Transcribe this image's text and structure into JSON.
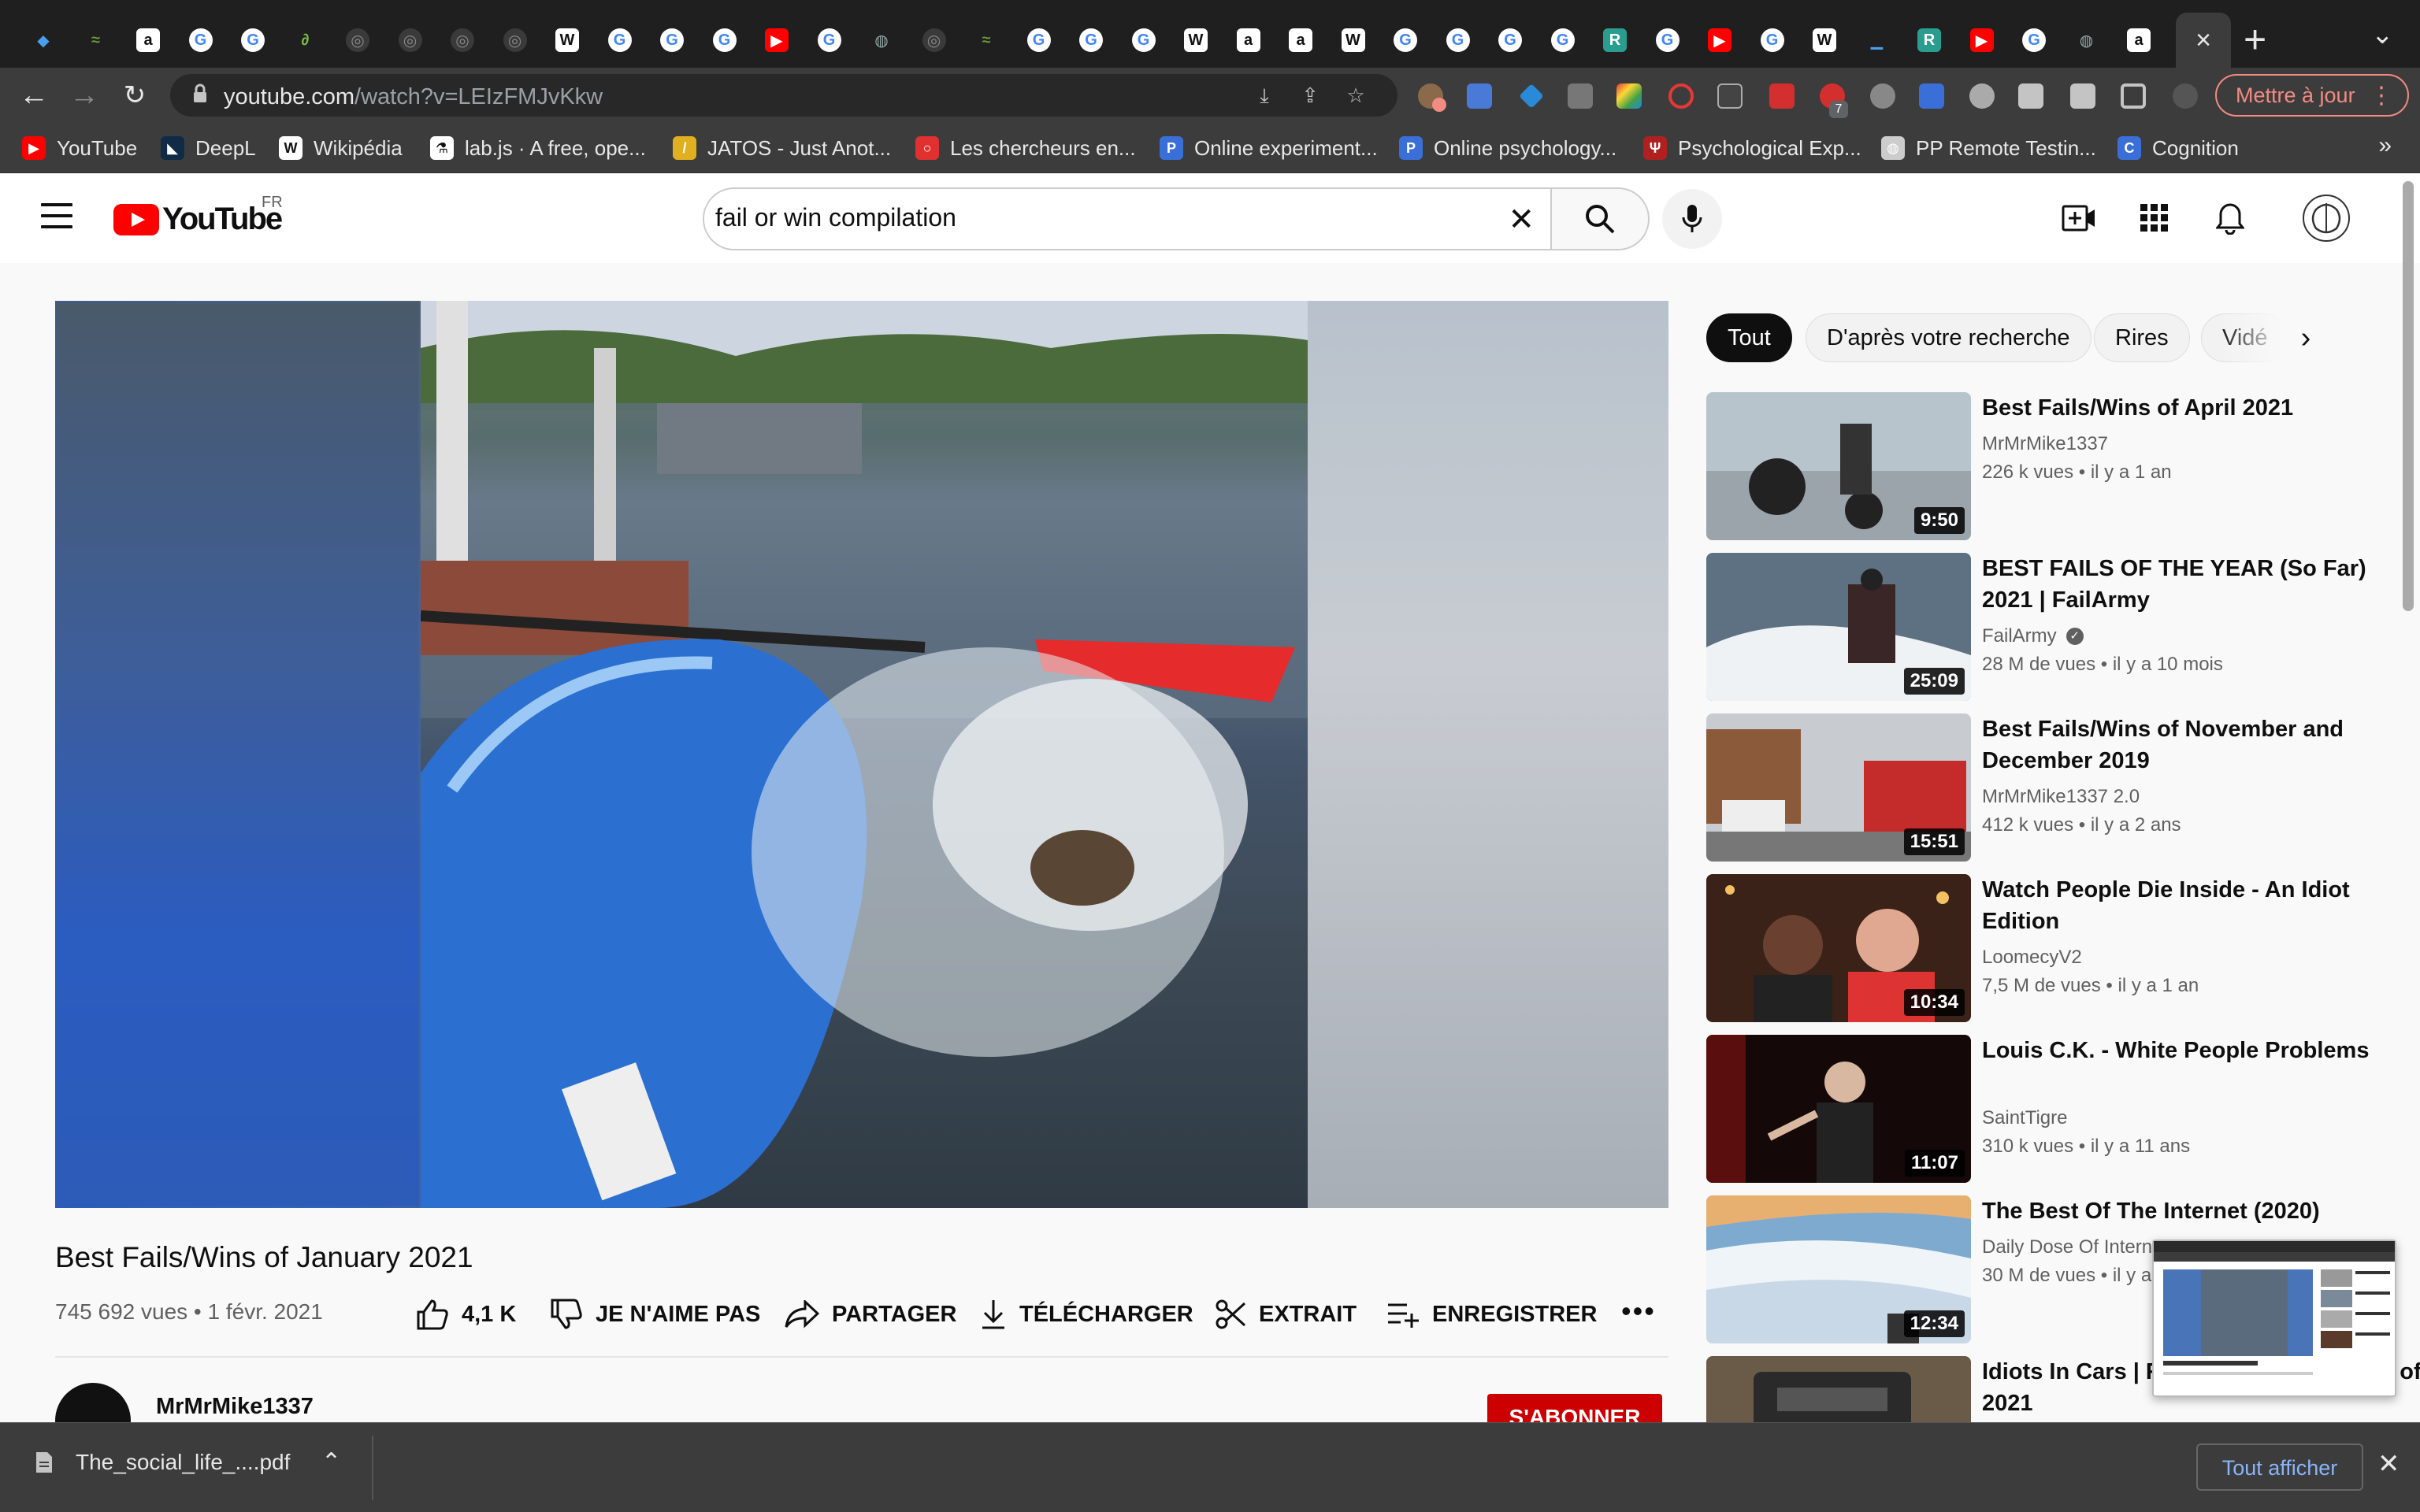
{
  "browser": {
    "tab_icons": [
      "diamond-icon",
      "wave-icon",
      "amazon-icon",
      "google-icon",
      "google-icon",
      "leaf-icon",
      "github-icon",
      "github-icon",
      "github-icon",
      "github-icon",
      "wikipedia-icon",
      "google-icon",
      "google-icon",
      "google-icon",
      "youtube-icon",
      "google-icon",
      "globe-icon",
      "github-icon",
      "wave-icon",
      "google-icon",
      "google-icon",
      "google-icon",
      "wikipedia-icon",
      "amazon-icon",
      "amazon-icon",
      "wikipedia-icon",
      "google-icon",
      "google-icon",
      "google-icon",
      "google-icon",
      "r-icon",
      "google-icon",
      "youtube-icon",
      "google-icon",
      "wikipedia-icon",
      "bar-icon",
      "r-icon",
      "youtube-icon",
      "google-icon",
      "globe-icon",
      "amazon-icon"
    ],
    "active_tab_close": "×",
    "new_tab": "+",
    "url_host": "youtube.com",
    "url_path": "/watch?v=LEIzFMJvKkw",
    "update_button": "Mettre à jour",
    "extension_badge": "7"
  },
  "bookmarks": [
    {
      "label": "YouTube",
      "icon": "youtube-icon",
      "color": "#ff0000"
    },
    {
      "label": "DeepL",
      "icon": "deepl-icon",
      "color": "#0f2b46"
    },
    {
      "label": "Wikipédia",
      "icon": "wikipedia-icon",
      "color": "#ffffff"
    },
    {
      "label": "lab.js · A free, ope...",
      "icon": "flask-icon",
      "color": "#ffffff"
    },
    {
      "label": "JATOS - Just Anot...",
      "icon": "jatos-icon",
      "color": "#e0b020"
    },
    {
      "label": "Les chercheurs en...",
      "icon": "chat-bubble-icon",
      "color": "#e03030"
    },
    {
      "label": "Online experiment...",
      "icon": "p-icon",
      "color": "#3a6fd8"
    },
    {
      "label": "Online psychology...",
      "icon": "p-icon",
      "color": "#3a6fd8"
    },
    {
      "label": "Psychological Exp...",
      "icon": "psy-icon",
      "color": "#b02020"
    },
    {
      "label": "PP Remote Testin...",
      "icon": "globe-icon",
      "color": "#cccccc"
    },
    {
      "label": "Cognition",
      "icon": "cognition-icon",
      "color": "#3a6fd8"
    }
  ],
  "bookmarks_more": "»",
  "youtube": {
    "logo_text": "YouTube",
    "country": "FR",
    "search_query": "fail or win compilation"
  },
  "video": {
    "title": "Best Fails/Wins of January 2021",
    "views": "745 692 vues • 1 févr. 2021",
    "likes": "4,1 K",
    "dislike": "JE N'AIME PAS",
    "share": "PARTAGER",
    "download": "TÉLÉCHARGER",
    "clip": "EXTRAIT",
    "save": "ENREGISTRER",
    "channel": "MrMrMike1337",
    "subscribe": "S'ABONNER"
  },
  "chips": [
    "Tout",
    "D'après votre recherche",
    "Rires",
    "Vidé"
  ],
  "recommendations": [
    {
      "title": "Best Fails/Wins of April 2021",
      "channel": "MrMrMike1337",
      "verified": false,
      "meta": "226 k vues • il y a 1 an",
      "duration": "9:50"
    },
    {
      "title": "BEST FAILS OF THE YEAR (So Far) 2021 | FailArmy",
      "channel": "FailArmy",
      "verified": true,
      "meta": "28 M de vues • il y a 10 mois",
      "duration": "25:09"
    },
    {
      "title": "Best Fails/Wins of November and December 2019",
      "channel": "MrMrMike1337 2.0",
      "verified": false,
      "meta": "412 k vues • il y a 2 ans",
      "duration": "15:51"
    },
    {
      "title": "Watch People Die Inside - An Idiot Edition",
      "channel": "LoomecyV2",
      "verified": false,
      "meta": "7,5 M de vues • il y a 1 an",
      "duration": "10:34"
    },
    {
      "title": "Louis C.K. - White People Problems",
      "channel": "SaintTigre",
      "verified": false,
      "meta": "310 k vues • il y a 11 ans",
      "duration": "11:07"
    },
    {
      "title": "The Best Of The Internet (2020)",
      "channel": "Daily Dose Of Internet",
      "verified": false,
      "meta": "30 M de vues • il y a 1 an",
      "duration": "12:34"
    },
    {
      "title": "Idiots In Cars | Ridiculous Driver Fails of 2021",
      "channel": "",
      "verified": false,
      "meta": "",
      "duration": ""
    }
  ],
  "downloads": {
    "filename": "The_social_life_....pdf",
    "show_all": "Tout afficher"
  }
}
